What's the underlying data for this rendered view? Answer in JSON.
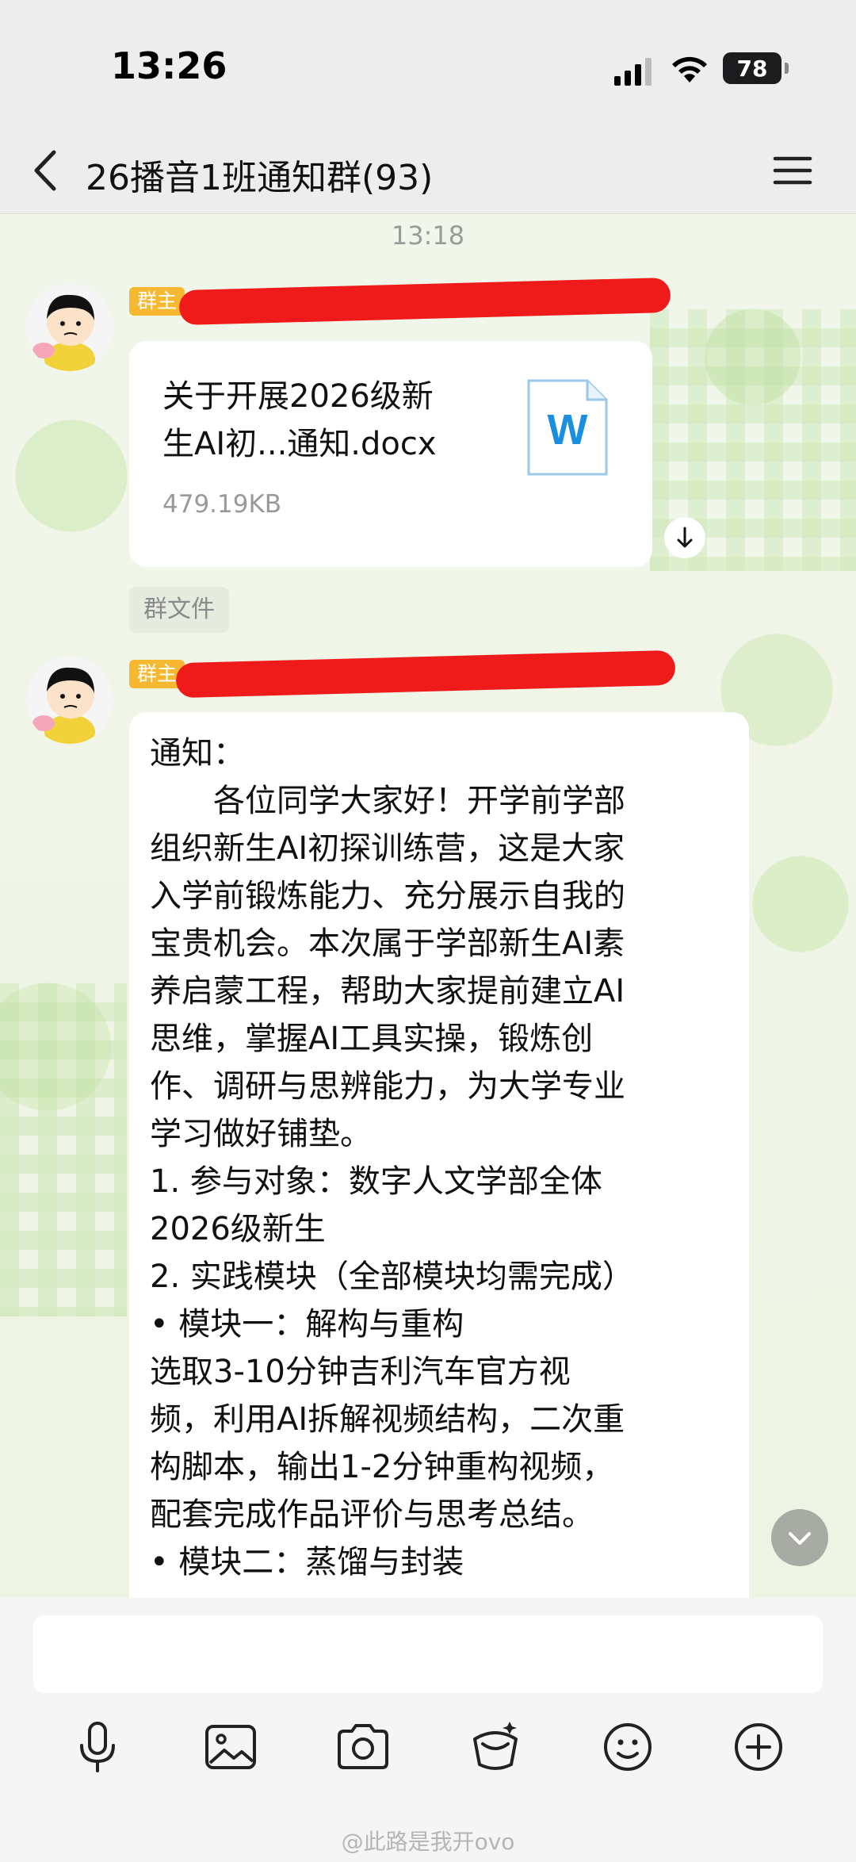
{
  "status_bar": {
    "time": "13:26",
    "battery": "78"
  },
  "nav": {
    "title": "26播音1班通知群(93)"
  },
  "chat": {
    "time_divider": "13:18",
    "owner_badge": "群主",
    "file_message": {
      "name_line1": "关于开展2026级新",
      "name_line2": "生AI初...通知.docx",
      "size": "479.19KB",
      "icon_letter": "W"
    },
    "group_file_tag": "群文件",
    "text_message": {
      "lines": [
        "通知：",
        "　　各位同学大家好！开学前学部",
        "组织新生AI初探训练营，这是大家",
        "入学前锻炼能力、充分展示自我的",
        "宝贵机会。本次属于学部新生AI素",
        "养启蒙工程，帮助大家提前建立AI",
        "思维，掌握AI工具实操，锻炼创",
        "作、调研与思辨能力，为大学专业",
        "学习做好铺垫。",
        "1. 参与对象：数字人文学部全体",
        " 2026级新生",
        "2. 实践模块（全部模块均需完成）",
        "• 模块一：解构与重构",
        "选取3-10分钟吉利汽车官方视",
        "频，利用AI拆解视频结构，二次重",
        "构脚本，输出1-2分钟重构视频，",
        "配套完成作品评价与思考总结。",
        "• 模块二：蒸馏与封装"
      ]
    }
  },
  "toolbar": {
    "icons": [
      "microphone-icon",
      "image-icon",
      "camera-icon",
      "red-packet-icon",
      "emoji-icon",
      "plus-icon"
    ]
  },
  "watermark": "@此路是我开ovo",
  "colors": {
    "owner_badge": "#f5b830",
    "redaction": "#ef1b1b",
    "word_blue": "#1a8fe0"
  }
}
